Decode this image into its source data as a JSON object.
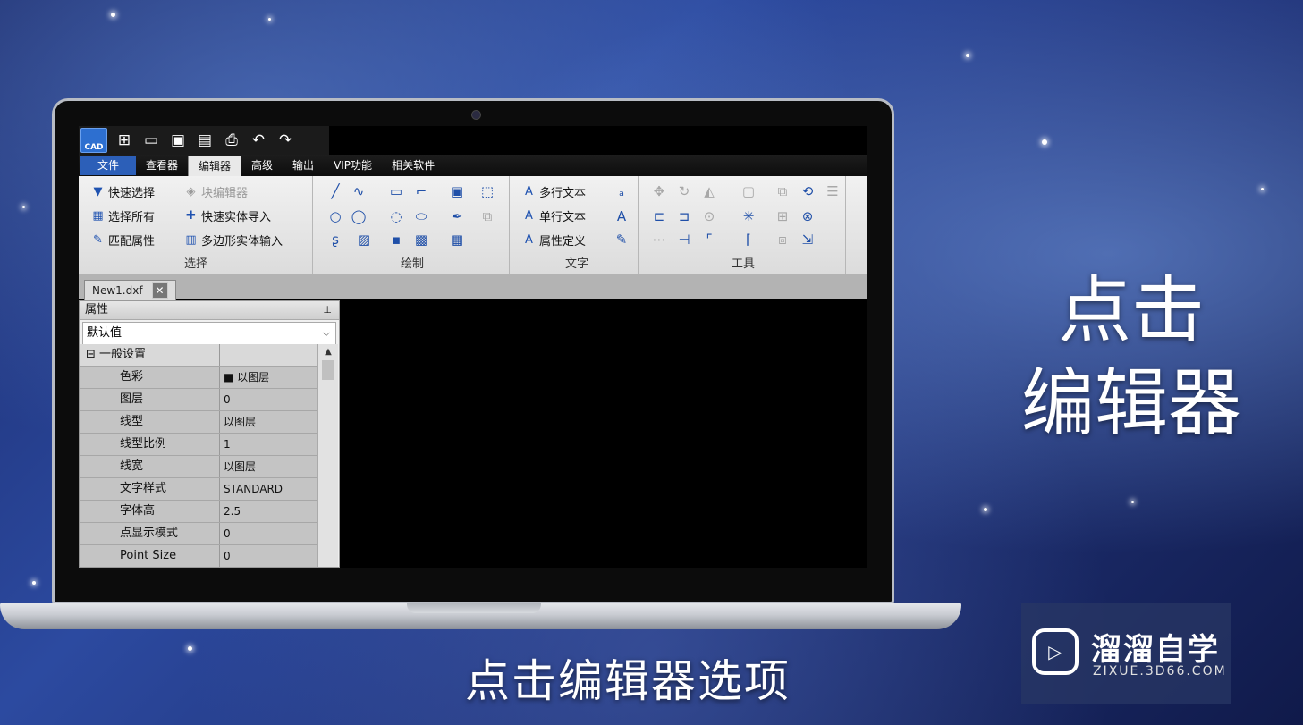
{
  "app": {
    "logo_text": "CAD",
    "quick_access_icons": [
      "new-icon",
      "open-folder-icon",
      "save-icon",
      "save-as-icon",
      "print-icon",
      "undo-icon",
      "redo-icon"
    ]
  },
  "menu": {
    "items": [
      "文件",
      "查看器",
      "编辑器",
      "高级",
      "输出",
      "VIP功能",
      "相关软件"
    ],
    "active": "编辑器"
  },
  "ribbon": {
    "select_group": {
      "label": "选择",
      "buttons": [
        "快速选择",
        "选择所有",
        "匹配属性"
      ]
    },
    "block_group": {
      "buttons": [
        "块编辑器",
        "快速实体导入",
        "多边形实体输入"
      ]
    },
    "draw_group": {
      "label": "绘制"
    },
    "text_group": {
      "label": "文字",
      "buttons": [
        "多行文本",
        "单行文本",
        "属性定义"
      ]
    },
    "tools_group": {
      "label": "工具"
    }
  },
  "document_tab": {
    "name": "New1.dxf",
    "close_glyph": "✕"
  },
  "properties": {
    "title": "属性",
    "pin_glyph": "📌",
    "selected_preset": "默认值",
    "section": "一般设置",
    "rows": [
      {
        "name": "色彩",
        "value": "以图层"
      },
      {
        "name": "图层",
        "value": "0"
      },
      {
        "name": "线型",
        "value": "以图层"
      },
      {
        "name": "线型比例",
        "value": "1"
      },
      {
        "name": "线宽",
        "value": "以图层"
      },
      {
        "name": "文字样式",
        "value": "STANDARD"
      },
      {
        "name": "字体高",
        "value": "2.5"
      },
      {
        "name": "点显示模式",
        "value": "0"
      },
      {
        "name": "Point Size",
        "value": "0"
      }
    ]
  },
  "overlay": {
    "side_line1": "点击",
    "side_line2": "编辑器",
    "caption": "点击编辑器选项"
  },
  "watermark": {
    "title": "溜溜自学",
    "url": "ZIXUE.3D66.COM"
  }
}
